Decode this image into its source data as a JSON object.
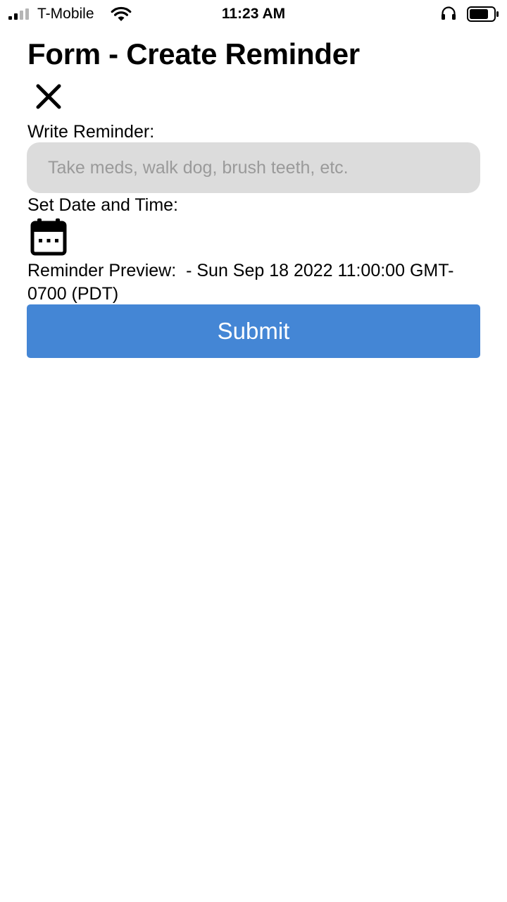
{
  "status_bar": {
    "carrier": "T-Mobile",
    "time": "11:23 AM",
    "icons": [
      "signal-icon",
      "wifi-icon",
      "headphones-icon",
      "battery-icon"
    ]
  },
  "form": {
    "title": "Form - Create Reminder",
    "close_icon": "close-icon",
    "write_label": "Write Reminder:",
    "reminder_input": {
      "value": "",
      "placeholder": "Take meds, walk dog, brush teeth, etc."
    },
    "date_label": "Set Date and Time:",
    "calendar_icon": "calendar-icon",
    "preview_label": "Reminder Preview:",
    "preview_value": "- Sun Sep 18 2022 11:00:00 GMT-0700 (PDT)",
    "submit_label": "Submit"
  },
  "colors": {
    "accent": "#4486d5",
    "input_background": "#dcdcdc",
    "placeholder": "#9a9a9a"
  }
}
